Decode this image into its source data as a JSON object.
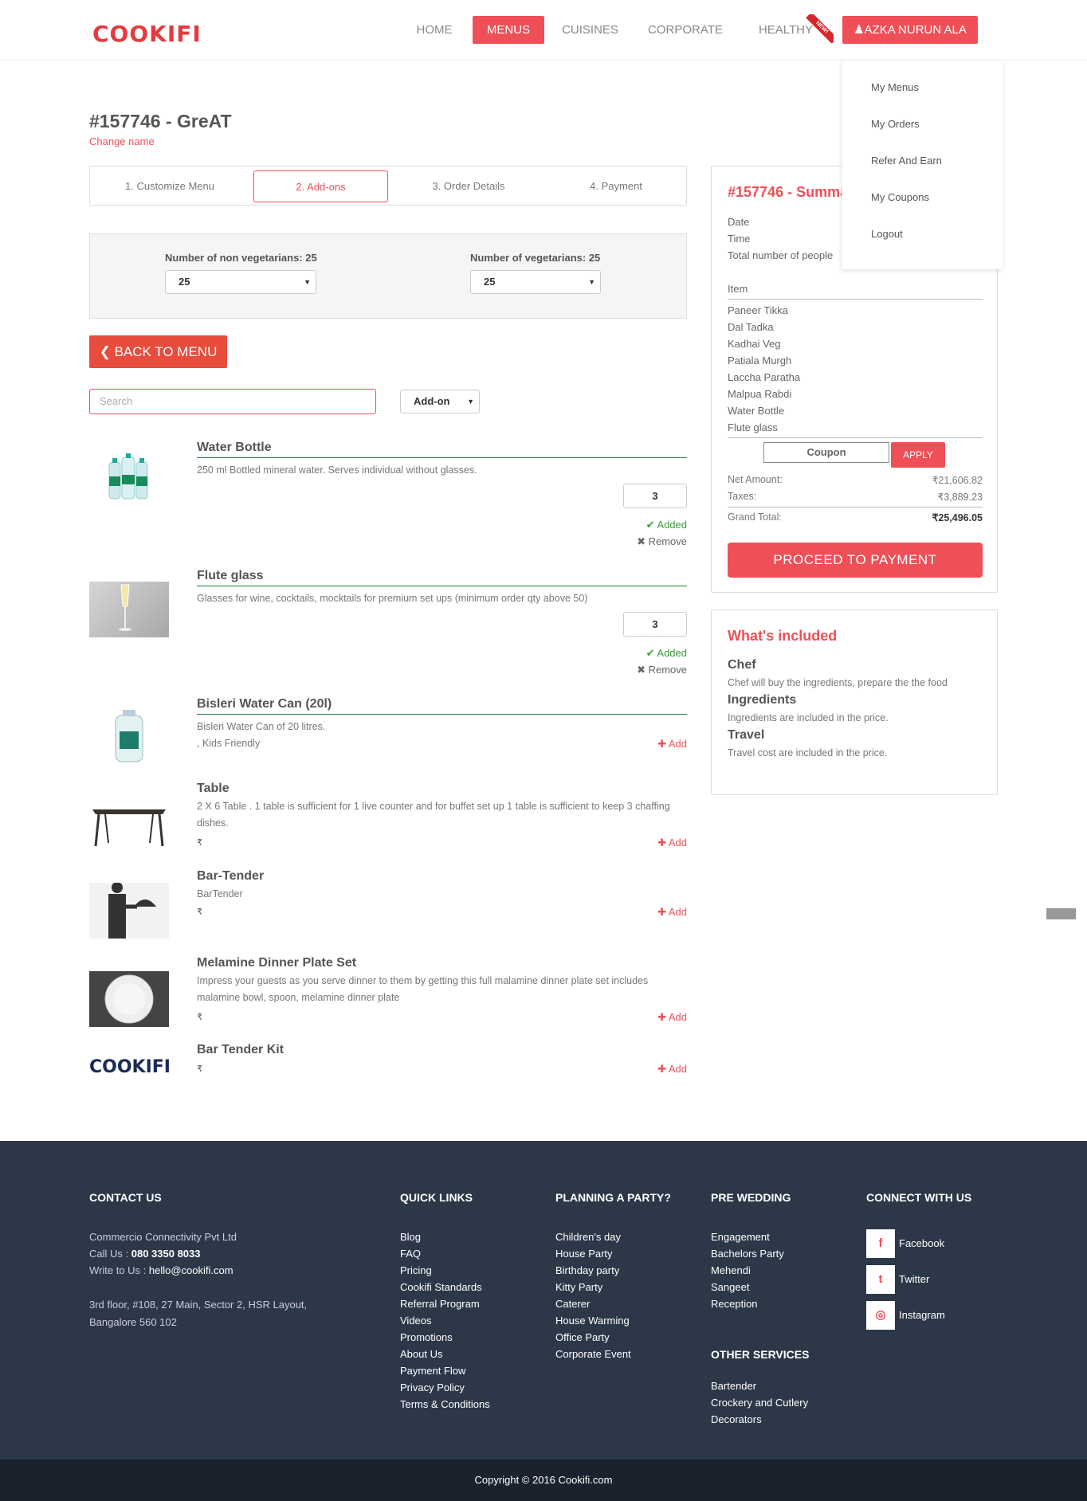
{
  "header": {
    "logo": "COOKIFI",
    "nav": [
      {
        "label": "HOME",
        "active": false
      },
      {
        "label": "MENUS",
        "active": true
      },
      {
        "label": "CUISINES",
        "active": false
      },
      {
        "label": "CORPORATE",
        "active": false
      },
      {
        "label": "HEALTHY",
        "active": false
      }
    ],
    "new_badge": "NEW!",
    "user_label": "AZKA NURUN ALA",
    "user_menu": [
      "My Menus",
      "My Orders",
      "Refer And Earn",
      "My Coupons",
      "Logout"
    ]
  },
  "menu": {
    "title": "#157746 - GreAT",
    "change_name": "Change name"
  },
  "steps": [
    {
      "label": "1. Customize Menu",
      "active": false
    },
    {
      "label": "2. Add-ons",
      "active": true
    },
    {
      "label": "3. Order Details",
      "active": false
    },
    {
      "label": "4. Payment",
      "active": false
    }
  ],
  "guests": {
    "nonveg_label": "Number of non vegetarians: 25",
    "nonveg_value": "25",
    "veg_label": "Number of vegetarians: 25",
    "veg_value": "25"
  },
  "back_button": "BACK TO MENU",
  "search": {
    "placeholder": "Search"
  },
  "filter": {
    "value": "Add-on"
  },
  "addons": [
    {
      "name": "Water Bottle",
      "description": "250 ml Bottled mineral water. Serves individual without glasses.",
      "qty": "3",
      "added_label": "Added",
      "remove_label": "Remove"
    },
    {
      "name": "Flute glass",
      "description": "Glasses for wine, cocktails, mocktails for premium set ups (minimum order qty above 50)",
      "qty": "3",
      "added_label": "Added",
      "remove_label": "Remove"
    },
    {
      "name": "Bisleri Water Can (20l)",
      "description": "Bisleri Water Can of 20 litres.",
      "tag": ", Kids Friendly",
      "add_label": "Add"
    },
    {
      "name": "Table",
      "description": "2 X 6 Table . 1 table is sufficient for 1 live counter and for buffet set up 1 table is sufficient to keep 3 chaffing dishes.",
      "price": "₹",
      "add_label": "Add"
    },
    {
      "name": "Bar-Tender",
      "description": "BarTender",
      "price": "₹",
      "add_label": "Add"
    },
    {
      "name": "Melamine Dinner Plate Set",
      "description": "Impress your guests as you serve dinner to them by getting this full malamine dinner plate set includes malamine bowl, spoon, melamine dinner plate",
      "price": "₹",
      "add_label": "Add"
    },
    {
      "name": "Bar Tender Kit",
      "price": "₹",
      "add_label": "Add",
      "logo": "COOKIFI"
    }
  ],
  "summary": {
    "title": "#157746 - Summary",
    "date_label": "Date",
    "time_label": "Time",
    "people_label": "Total number of people",
    "item_header": "Item",
    "items": [
      "Paneer Tikka",
      "Dal Tadka",
      "Kadhai Veg",
      "Patiala Murgh",
      "Laccha Paratha",
      "Malpua Rabdi",
      "Water Bottle",
      "Flute glass"
    ],
    "coupon_placeholder": "Coupon",
    "apply_label": "APPLY",
    "net_label": "Net Amount:",
    "net_value": "₹21,606.82",
    "tax_label": "Taxes:",
    "tax_value": "₹3,889.23",
    "grand_label": "Grand Total:",
    "grand_value": "₹25,496.05",
    "proceed_label": "PROCEED TO PAYMENT"
  },
  "included": {
    "title": "What's included",
    "items": [
      {
        "head": "Chef",
        "text": "Chef will buy the ingredients, prepare the the food"
      },
      {
        "head": "Ingredients",
        "text": "Ingredients are included in the price."
      },
      {
        "head": "Travel",
        "text": "Travel cost are included in the price."
      }
    ]
  },
  "footer": {
    "contact_head": "CONTACT US",
    "company": "Commercio Connectivity Pvt Ltd",
    "call_label": "Call Us : ",
    "phone": "080 3350 8033",
    "write_label": "Write to Us : ",
    "email": "hello@cookifi.com",
    "address1": "3rd floor, #108, 27 Main, Sector 2, HSR Layout,",
    "address2": "Bangalore 560 102",
    "quick_head": "QUICK LINKS",
    "quick_links": [
      "Blog",
      "FAQ",
      "Pricing",
      "Cookifi Standards",
      "Referral Program",
      "Videos",
      "Promotions",
      "About Us",
      "Payment Flow",
      "Privacy Policy",
      "Terms & Conditions"
    ],
    "party_head": "PLANNING A PARTY?",
    "party_links": [
      "Children's day",
      "House Party",
      "Birthday party",
      "Kitty Party",
      "Caterer",
      "House Warming",
      "Office Party",
      "Corporate Event"
    ],
    "wedding_head": "PRE WEDDING",
    "wedding_links": [
      "Engagement",
      "Bachelors Party",
      "Mehendi",
      "Sangeet",
      "Reception"
    ],
    "services_head": "OTHER SERVICES",
    "services_links": [
      "Bartender",
      "Crockery and Cutlery",
      "Decorators"
    ],
    "connect_head": "CONNECT WITH US",
    "social": [
      {
        "label": "Facebook",
        "icon": "f"
      },
      {
        "label": "Twitter",
        "icon": "t"
      },
      {
        "label": "Instagram",
        "icon": "◎"
      }
    ],
    "copyright": "Copyright © 2016 Cookifi.com"
  }
}
